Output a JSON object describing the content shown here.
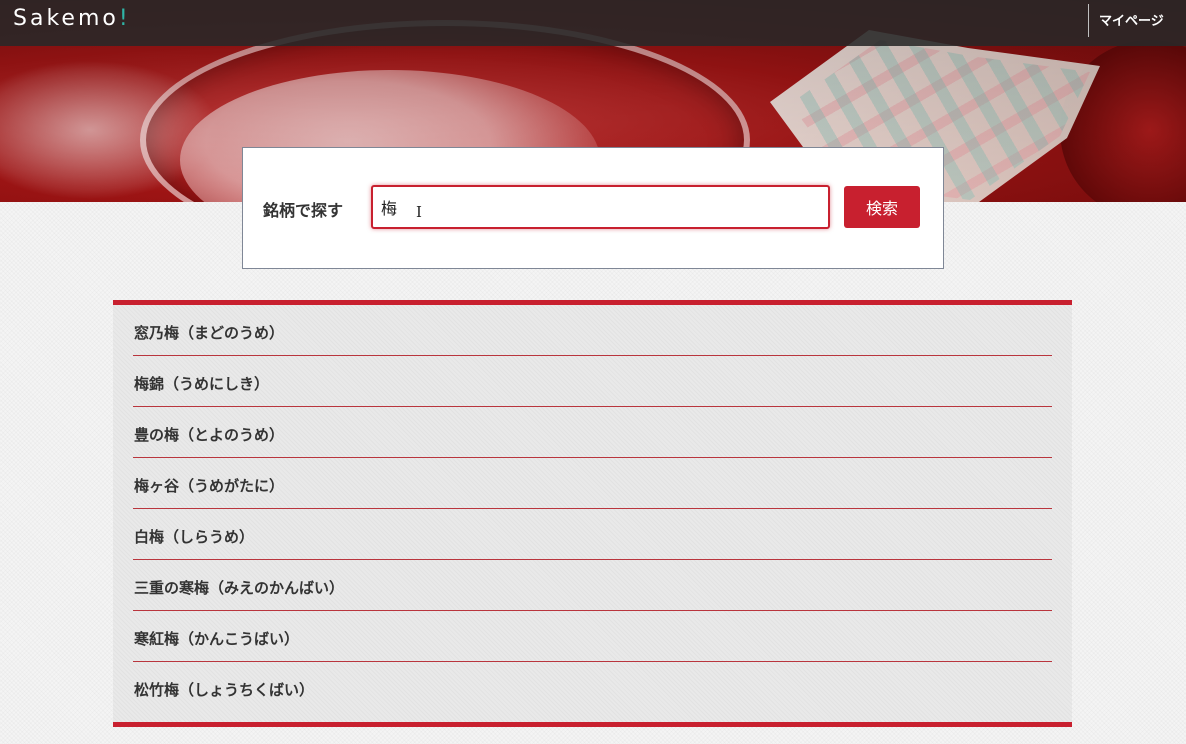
{
  "header": {
    "logo_text": "Sakemo",
    "logo_mark": "!",
    "mypage_label": "マイページ"
  },
  "search": {
    "label": "銘柄で探す",
    "query": "梅",
    "button_label": "検索"
  },
  "results": [
    "窓乃梅（まどのうめ）",
    "梅錦（うめにしき）",
    "豊の梅（とよのうめ）",
    "梅ヶ谷（うめがたに）",
    "白梅（しらうめ）",
    "三重の寒梅（みえのかんばい）",
    "寒紅梅（かんこうばい）",
    "松竹梅（しょうちくばい）"
  ],
  "colors": {
    "accent": "#c8202f",
    "logo_mark": "#2fb4a6",
    "topbar": "#282828"
  }
}
